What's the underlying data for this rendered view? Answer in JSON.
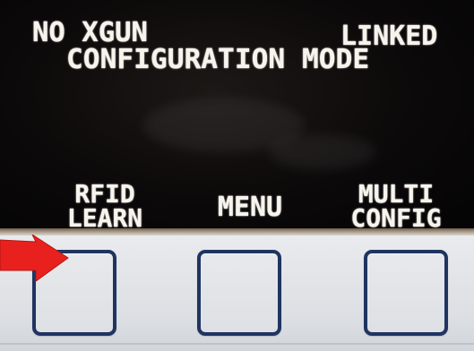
{
  "screen": {
    "status_left": "NO XGUN",
    "status_right": "LINKED",
    "mode_title": "CONFIGURATION MODE",
    "softkeys": [
      {
        "line1": "RFID",
        "line2": "LEARN"
      },
      {
        "line1": "MENU",
        "line2": ""
      },
      {
        "line1": "MULTI",
        "line2": "CONFIG"
      }
    ]
  },
  "colors": {
    "screen_bg": "#0b0909",
    "lcd_text": "#f7f4ec",
    "key_border": "#1f3461",
    "panel": "#e4e6ea",
    "arrow": "#e8211f"
  },
  "icons": {
    "pointer": "red-arrow-icon"
  }
}
